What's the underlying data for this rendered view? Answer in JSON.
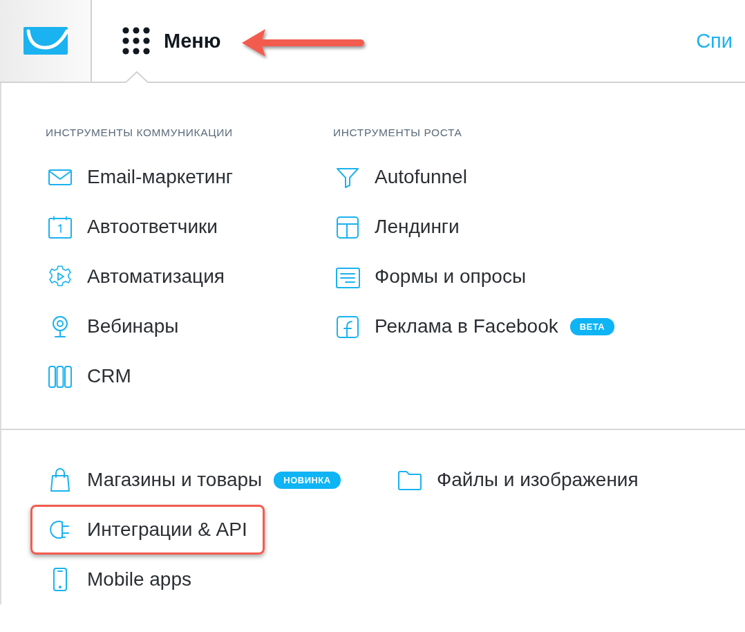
{
  "header": {
    "menu_button": {
      "label": "Меню",
      "pointer_arrow": true
    },
    "nav_link": "Спи"
  },
  "menu": {
    "sections": [
      {
        "heading": "ИНСТРУМЕНТЫ КОММУНИКАЦИИ",
        "items": [
          {
            "label": "Email-маркетинг"
          },
          {
            "label": "Автоответчики"
          },
          {
            "label": "Автоматизация"
          },
          {
            "label": "Вебинары"
          },
          {
            "label": "CRM"
          }
        ]
      },
      {
        "heading": "ИНСТРУМЕНТЫ РОСТА",
        "items": [
          {
            "label": "Autofunnel"
          },
          {
            "label": "Лендинги"
          },
          {
            "label": "Формы и опросы"
          },
          {
            "label": "Реклама в Facebook",
            "badge": "BETA"
          }
        ]
      }
    ],
    "more_columns": [
      [
        {
          "label": "Магазины и товары",
          "badge": "НОВИНКА",
          "highlighted": false
        },
        {
          "label": "Интеграции & API",
          "highlighted": true
        },
        {
          "label": "Mobile apps",
          "highlighted": false
        }
      ],
      [
        {
          "label": "Файлы и изображения",
          "highlighted": false
        }
      ]
    ]
  }
}
